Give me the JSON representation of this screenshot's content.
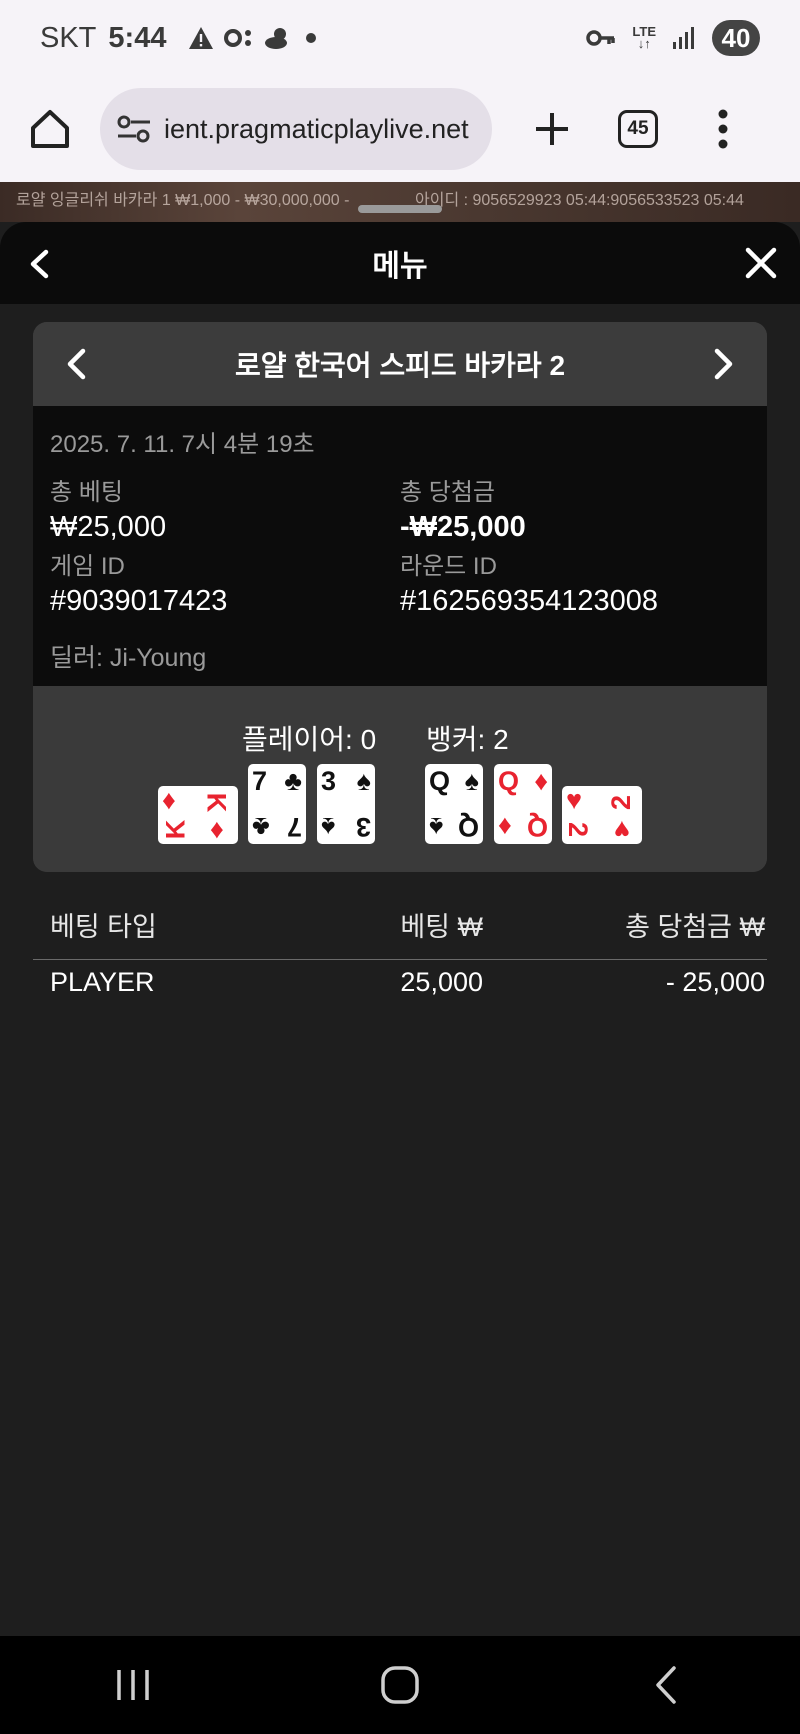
{
  "status_bar": {
    "carrier": "SKT",
    "time": "5:44",
    "network": "LTE",
    "battery": "40",
    "icons": [
      "warning-icon",
      "toggle-icon",
      "weather-icon",
      "dot-icon",
      "key-icon",
      "lte-icon",
      "signal-icon"
    ]
  },
  "browser": {
    "url": "ient.pragmaticplaylive.net",
    "tab_count": "45",
    "icons": [
      "home-icon",
      "site-settings-icon",
      "plus-icon",
      "more-vert-icon"
    ]
  },
  "video_overlay": {
    "left_text": "로얄 잉글리쉬 바카라 1 ₩1,000 - ₩30,000,000 -",
    "right_text": "아이디 : 9056529923 05:44:9056533523  05:44"
  },
  "panel": {
    "title": "메뉴"
  },
  "history_card": {
    "game_name": "로얄 한국어 스피드 바카라 2",
    "date": "2025. 7. 11. 7시 4분 19초",
    "total_bet_label": "총 베팅",
    "total_bet_value": "₩25,000",
    "total_win_label": "총 당첨금",
    "total_win_value": "-₩25,000",
    "game_id_label": "게임 ID",
    "game_id_value": "#9039017423",
    "round_id_label": "라운드 ID",
    "round_id_value": "#162569354123008",
    "dealer": "딜러: Ji-Young"
  },
  "result": {
    "player_score": "플레이어: 0",
    "banker_score": "뱅커: 2",
    "player_cards": [
      {
        "rank": "K",
        "suit": "♦",
        "color": "#e8232f"
      },
      {
        "rank": "7",
        "suit": "♣",
        "color": "#111111"
      },
      {
        "rank": "3",
        "suit": "♠",
        "color": "#111111"
      }
    ],
    "banker_cards": [
      {
        "rank": "Q",
        "suit": "♠",
        "color": "#111111"
      },
      {
        "rank": "Q",
        "suit": "♦",
        "color": "#e8232f"
      },
      {
        "rank": "2",
        "suit": "♥",
        "color": "#e8232f"
      }
    ]
  },
  "bets_table": {
    "headers": [
      "베팅 타입",
      "베팅 ₩",
      "총 당첨금 ₩"
    ],
    "rows": [
      [
        "PLAYER",
        "25,000",
        "- 25,000"
      ]
    ]
  },
  "colors": {
    "panel_bg": "#1e1e1e",
    "header_bg": "#0b0b0b",
    "card_bg": "#3a3a3a",
    "red_suit": "#e8232f"
  }
}
